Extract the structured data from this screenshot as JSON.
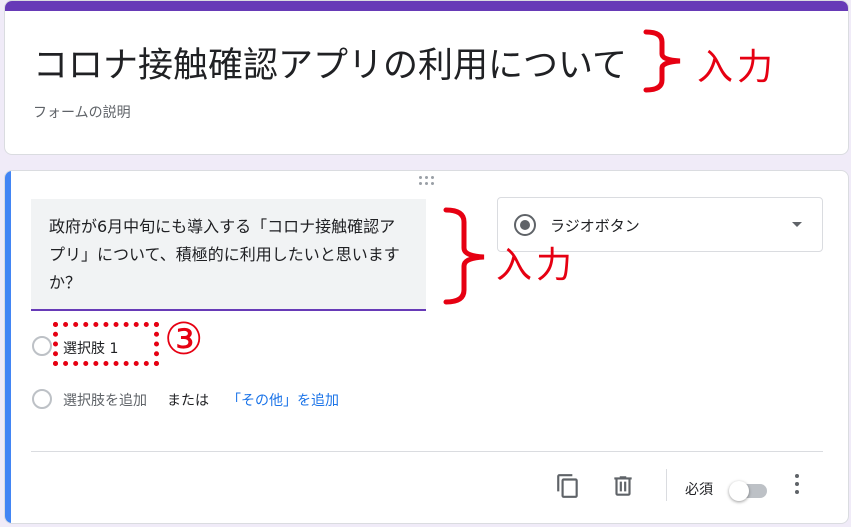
{
  "form": {
    "title": "コロナ接触確認アプリの利用について",
    "description_placeholder": "フォームの説明"
  },
  "question": {
    "text": "政府が6月中旬にも導入する「コロナ接触確認アプリ」について、積極的に利用したいと思いますか？",
    "type_label": "ラジオボタン",
    "options": [
      "選択肢 1"
    ],
    "add_option": "選択肢を追加",
    "or_text": "または",
    "add_other": "「その他」を追加",
    "required_label": "必須",
    "required": false
  },
  "annotations": {
    "input_label_1": "入力",
    "input_label_2": "入力",
    "step_number": "③"
  },
  "colors": {
    "theme": "#673ab7",
    "active_bar": "#4285f4",
    "annotation": "#e60012"
  }
}
